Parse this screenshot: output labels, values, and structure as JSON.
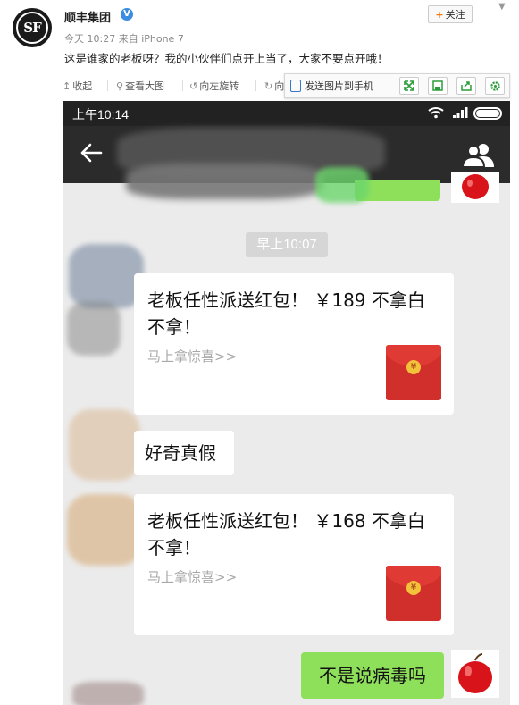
{
  "post": {
    "author": "顺丰集团",
    "meta": "今天 10:27 来自 iPhone 7",
    "text": "这是谁家的老板呀？我的小伙伴们点开上当了，大家不要点开哦！",
    "follow_label": "关注",
    "follow_plus": "+",
    "verified_mark": "V"
  },
  "toolbar": {
    "collapse": "收起",
    "view_large": "查看大图",
    "rotate_left": "向左旋转",
    "rotate_right": "向",
    "send_to_phone": "发送图片到手机"
  },
  "phone": {
    "status_time": "上午10:14",
    "timestamp": "早上10:07",
    "red_packets": [
      {
        "title": "老板任性派送红包！ ￥189 不拿白不拿！",
        "subtitle": "马上拿惊喜>>"
      },
      {
        "title": "老板任性派送红包！ ￥168 不拿白不拿！",
        "subtitle": "马上拿惊喜>>"
      }
    ],
    "coin_glyph": "¥",
    "msg_curious": "好奇真假",
    "msg_not_virus": "不是说病毒吗"
  },
  "colors": {
    "chat_bg": "#ebebeb",
    "navbar": "#2b2b2b",
    "green_bubble": "#8ee05b",
    "red_packet": "#d02f2b",
    "follow_accent": "#f47a10"
  }
}
